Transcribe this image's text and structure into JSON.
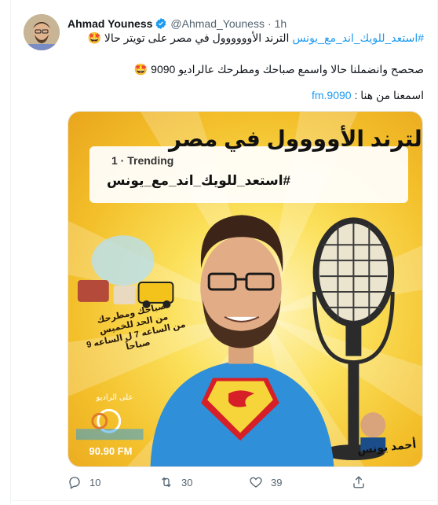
{
  "tweet": {
    "author_name": "Ahmad Youness",
    "author_handle": "@Ahmad_Youness",
    "separator": "·",
    "time": "1h",
    "line1_hashtag": "#استعد_للويك_اند_مع_يونس",
    "line1_text": " الترند الأوووووول في مصر على تويتر حالا ",
    "line1_emoji": "🤩",
    "line2_text": "صحصح وانضملنا حالا واسمع صباحك ومطرحك عالراديو 9090 ",
    "line2_emoji": "🤩",
    "line3_text": "اسمعنا من هنا : ",
    "line3_link": "9090.fm"
  },
  "media": {
    "headline": "الترند الأوووول في مصر",
    "trend_meta": "1 · Trending",
    "trend_tag": "#استعد_للويك_اند_مع_يونس",
    "promo_title": "صباحك ومطرحك",
    "promo_days": "من الحد للخميس",
    "promo_hours": "من الساعه 7 ل الساعه 9 صباحاً",
    "radio_label": "على الراديو",
    "radio_freq": "90.90 FM",
    "signature": "أحمد يونس"
  },
  "actions": {
    "reply_count": "10",
    "retweet_count": "30",
    "like_count": "39"
  },
  "colors": {
    "accent": "#1d9bf0",
    "muted": "#536471",
    "text": "#0f1419"
  }
}
